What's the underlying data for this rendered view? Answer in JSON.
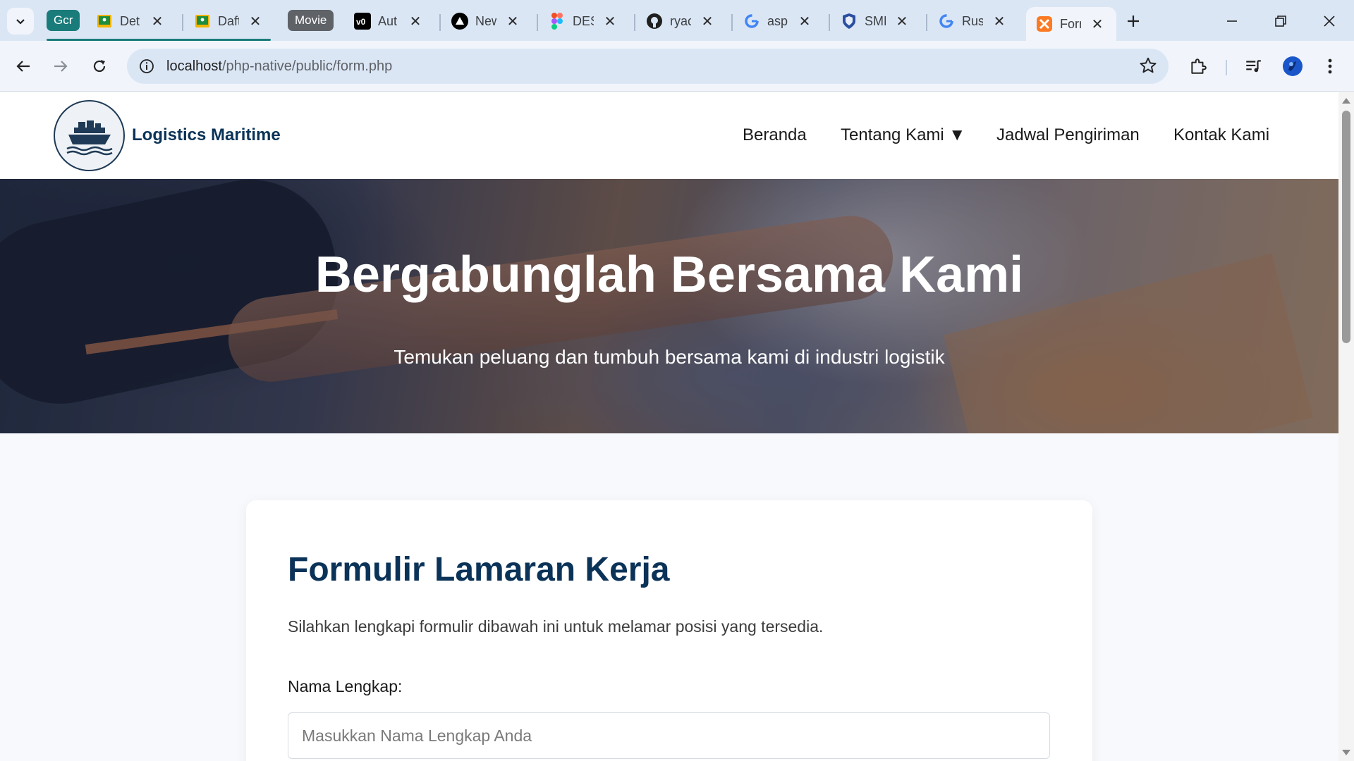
{
  "browser": {
    "tabs": [
      {
        "label": "Det",
        "icon": "google-classroom-icon",
        "color": "#f4b400"
      },
      {
        "label": "Daft",
        "icon": "google-classroom-icon",
        "color": "#f4b400"
      },
      {
        "label": "Aut",
        "icon": "vercel-v0-icon",
        "color": "#000000"
      },
      {
        "label": "New",
        "icon": "vercel-triangle-icon",
        "color": "#000000"
      },
      {
        "label": "DES",
        "icon": "figma-icon",
        "color": "#f24e1e"
      },
      {
        "label": "ryac",
        "icon": "github-icon",
        "color": "#1f1f1f"
      },
      {
        "label": "asp",
        "icon": "google-icon",
        "color": "#4285f4"
      },
      {
        "label": "SMK",
        "icon": "shield-icon",
        "color": "#2b4fa0"
      },
      {
        "label": "Rus",
        "icon": "google-icon",
        "color": "#4285f4"
      },
      {
        "label": "Forr",
        "icon": "xampp-icon",
        "color": "#fb7a24"
      }
    ],
    "groups": [
      {
        "label": "Gcr",
        "color": "#1a7c7a"
      },
      {
        "label": "Movie",
        "color": "#5f6368"
      }
    ],
    "url_host": "localhost",
    "url_path": "/php-native/public/form.php"
  },
  "site": {
    "brand": "Logistics Maritime",
    "nav": {
      "home": "Beranda",
      "about": "Tentang Kami ▼",
      "schedule": "Jadwal Pengiriman",
      "contact": "Kontak Kami"
    }
  },
  "hero": {
    "title": "Bergabunglah Bersama Kami",
    "subtitle": "Temukan peluang dan tumbuh bersama kami di industri logistik"
  },
  "form": {
    "title": "Formulir Lamaran Kerja",
    "description": "Silahkan lengkapi formulir dibawah ini untuk melamar posisi yang tersedia.",
    "name_label": "Nama Lengkap:",
    "name_placeholder": "Masukkan Nama Lengkap Anda",
    "name_value": ""
  }
}
